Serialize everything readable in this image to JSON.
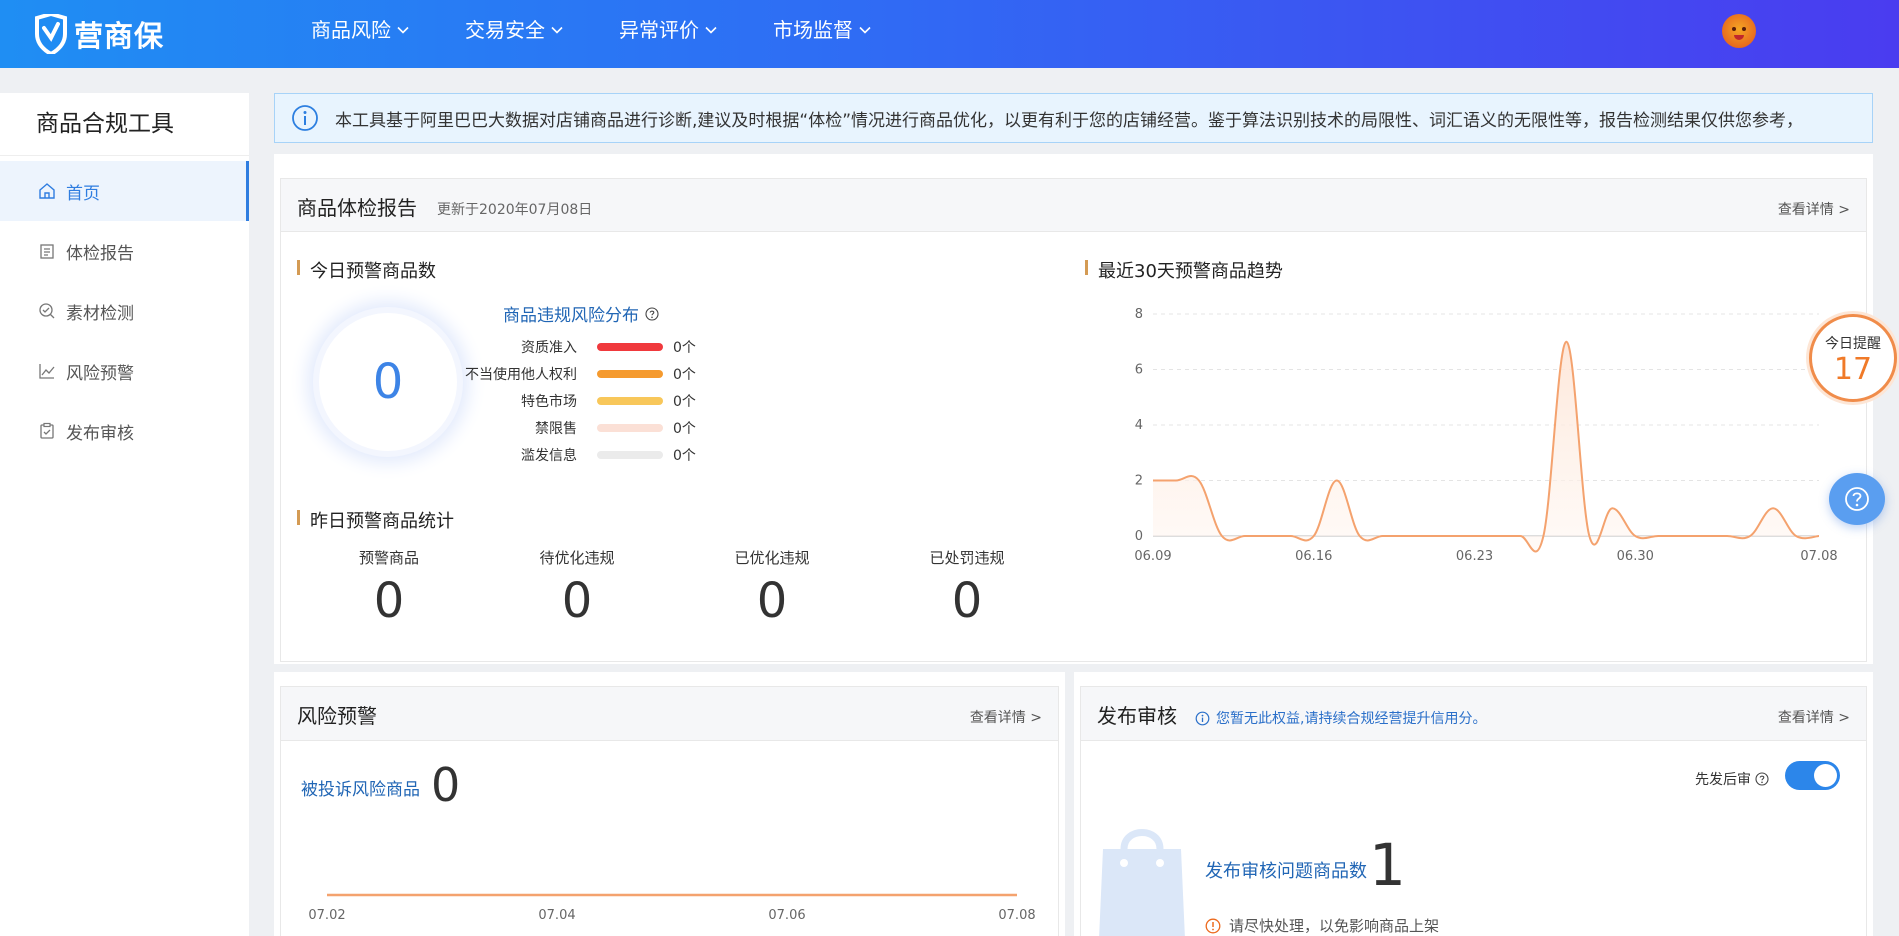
{
  "brand": {
    "logo_text": "营商保"
  },
  "nav": {
    "items": [
      {
        "label": "商品风险"
      },
      {
        "label": "交易安全"
      },
      {
        "label": "异常评价"
      },
      {
        "label": "市场监督"
      }
    ]
  },
  "sidebar": {
    "title": "商品合规工具",
    "items": [
      {
        "label": "首页",
        "active": true
      },
      {
        "label": "体检报告"
      },
      {
        "label": "素材检测"
      },
      {
        "label": "风险预警"
      },
      {
        "label": "发布审核"
      }
    ]
  },
  "notice": {
    "text": "本工具基于阿里巴巴大数据对店铺商品进行诊断,建议及时根据“体检”情况进行商品优化，以更有利于您的店铺经营。鉴于算法识别技术的局限性、词汇语义的无限性等，报告检测结果仅供您参考，"
  },
  "report": {
    "title": "商品体检报告",
    "updated": "更新于2020年07月08日",
    "more": "查看详情 >",
    "today_title": "今日预警商品数",
    "today_value": "0",
    "dist_title": "商品违规风险分布",
    "distribution": [
      {
        "label": "资质准入",
        "value": "0个",
        "color": "#f0393d"
      },
      {
        "label": "不当使用他人权利",
        "value": "0个",
        "color": "#f59a2e"
      },
      {
        "label": "特色市场",
        "value": "0个",
        "color": "#f8c75a"
      },
      {
        "label": "禁限售",
        "value": "0个",
        "color": "#fbe0d6"
      },
      {
        "label": "滥发信息",
        "value": "0个",
        "color": "#ebebeb"
      }
    ],
    "yesterday_title": "昨日预警商品统计",
    "yesterday_stats": [
      {
        "label": "预警商品",
        "value": "0"
      },
      {
        "label": "待优化违规",
        "value": "0"
      },
      {
        "label": "已优化违规",
        "value": "0"
      },
      {
        "label": "已处罚违规",
        "value": "0"
      }
    ],
    "trend_title": "最近30天预警商品趋势"
  },
  "chart_data": [
    {
      "type": "area",
      "title": "最近30天预警商品趋势",
      "x_ticks": [
        "06.09",
        "06.16",
        "06.23",
        "06.30",
        "07.08"
      ],
      "x": [
        "06.09",
        "06.10",
        "06.11",
        "06.12",
        "06.13",
        "06.14",
        "06.15",
        "06.16",
        "06.17",
        "06.18",
        "06.19",
        "06.20",
        "06.21",
        "06.22",
        "06.23",
        "06.24",
        "06.25",
        "06.26",
        "06.27",
        "06.28",
        "06.29",
        "06.30",
        "07.01",
        "07.02",
        "07.03",
        "07.04",
        "07.05",
        "07.06",
        "07.07",
        "07.08"
      ],
      "values": [
        2,
        2,
        2,
        0,
        0,
        0,
        0,
        0,
        2,
        0,
        0,
        0,
        0,
        0,
        0,
        0,
        0,
        0,
        7,
        0,
        1,
        0,
        0,
        0,
        0,
        0,
        0,
        1,
        0,
        0
      ],
      "ylim": [
        0,
        8
      ],
      "y_ticks": [
        0,
        2,
        4,
        6,
        8
      ],
      "color": "#f4a26e",
      "grid": true
    },
    {
      "type": "line",
      "x_ticks": [
        "07.02",
        "07.04",
        "07.06",
        "07.08"
      ],
      "values": [
        0,
        0,
        0,
        0
      ],
      "color": "#f4a26e"
    }
  ],
  "float": {
    "today_label": "今日提醒",
    "today_value": "17"
  },
  "risk": {
    "title": "风险预警",
    "more": "查看详情 >",
    "complaint_label": "被投诉风险商品",
    "complaint_value": "0"
  },
  "publish": {
    "title": "发布审核",
    "tip": "您暂无此权益,请持续合规经营提升信用分。",
    "more": "查看详情 >",
    "toggle_label": "先发后审",
    "toggle_on": true,
    "count_label": "发布审核问题商品数",
    "count_value": "1",
    "warn_text": "请尽快处理，以免影响商品上架"
  }
}
